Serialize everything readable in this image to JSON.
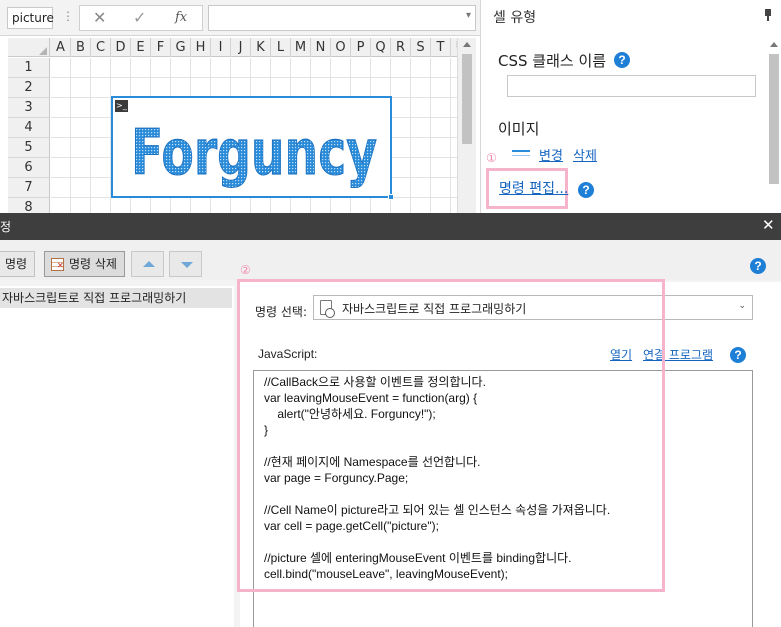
{
  "formula_bar": {
    "name_box": "picture",
    "cancel_icon": "close-icon",
    "confirm_icon": "check-icon",
    "function_label": "fx",
    "dropdown_icon": "chevron-down-icon"
  },
  "sheet": {
    "columns": [
      "A",
      "B",
      "C",
      "D",
      "E",
      "F",
      "G",
      "H",
      "I",
      "J",
      "K",
      "L",
      "M",
      "N",
      "O",
      "P",
      "Q",
      "R",
      "S",
      "T",
      "U"
    ],
    "rows": [
      "1",
      "2",
      "3",
      "4",
      "5",
      "6",
      "7",
      "8"
    ],
    "picture_text": "Forguncy",
    "accent_color": "#2a8bd8"
  },
  "cell_type_panel": {
    "title": "셀 유형",
    "css_class_label": "CSS 클래스 이름",
    "css_class_value": "",
    "image_label": "이미지",
    "image_change": "변경",
    "image_delete": "삭제",
    "marker_1": "①",
    "command_edit": "명령 편집...",
    "highlight_color": "#f5b4cc"
  },
  "dialog": {
    "title_fragment": "정",
    "close_glyph": "✕",
    "toolbar": {
      "add_label": "명령",
      "delete_label": "명령 삭제",
      "move_up_icon": "arrow-up-icon",
      "move_down_icon": "arrow-down-icon"
    },
    "command_list": [
      "자바스크립트로 직접 프로그래밍하기"
    ],
    "marker_2": "②",
    "command_select": {
      "label": "명령 선택:",
      "value": "자바스크립트로 직접 프로그래밍하기"
    },
    "javascript": {
      "label": "JavaScript:",
      "open_link": "열기",
      "program_link": "연결 프로그램",
      "code": "//CallBack으로 사용할 이벤트를 정의합니다.\nvar leavingMouseEvent = function(arg) {\n    alert(\"안녕하세요. Forguncy!\");\n}\n\n//현재 페이지에 Namespace를 선언합니다.\nvar page = Forguncy.Page;\n\n//Cell Name이 picture라고 되어 있는 셀 인스턴스 속성을 가져옵니다.\nvar cell = page.getCell(\"picture\");\n\n//picture 셀에 enteringMouseEvent 이벤트를 binding합니다.\ncell.bind(\"mouseLeave\", leavingMouseEvent);"
    }
  }
}
